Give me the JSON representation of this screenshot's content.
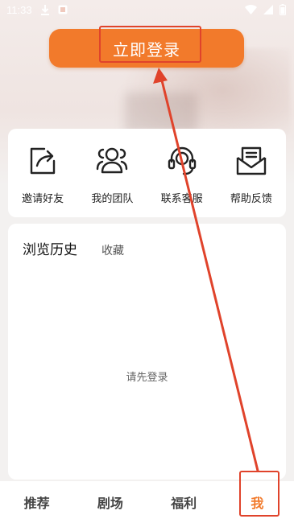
{
  "status_bar": {
    "time": "11:33",
    "left_icons": [
      "download-icon",
      "notification-icon"
    ],
    "right_icons": [
      "wifi-icon",
      "signal-icon",
      "battery-icon"
    ]
  },
  "login_button": {
    "label": "立即登录"
  },
  "quick_actions": [
    {
      "icon": "share-icon",
      "label": "邀请好友"
    },
    {
      "icon": "team-icon",
      "label": "我的团队"
    },
    {
      "icon": "headset-icon",
      "label": "联系客服"
    },
    {
      "icon": "mail-icon",
      "label": "帮助反馈"
    }
  ],
  "content": {
    "tabs": [
      "浏览历史",
      "收藏"
    ],
    "active_tab": "浏览历史",
    "empty_text": "请先登录"
  },
  "bottom_nav": {
    "items": [
      "推荐",
      "剧场",
      "福利",
      "我"
    ],
    "active": "我"
  },
  "colors": {
    "accent": "#f27a2b",
    "annotation": "#e0432b"
  }
}
